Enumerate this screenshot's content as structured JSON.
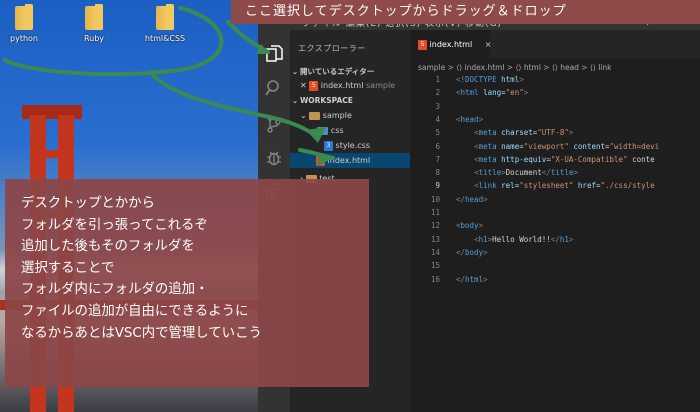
{
  "desktop": {
    "icons": [
      {
        "label": "python"
      },
      {
        "label": "Ruby"
      },
      {
        "label": "html&CSS"
      }
    ]
  },
  "banner": {
    "text": "ここ選択してデスクトップからドラッグ＆ドロップ"
  },
  "note": {
    "lines": [
      "デスクトップとかから",
      "フォルダを引っ張ってこれるぞ",
      "追加した後もそのフォルダを",
      "選択することで",
      "フォルダ内にフォルダの追加・",
      "ファイルの追加が自由にできるように",
      "なるからあとはVSC内で管理していこう"
    ]
  },
  "vscode": {
    "menubar": {
      "items": "ファイル  編集(E)  選択(S)  表示(V)  移動(G)",
      "window_title": "index.html - workspace - Visu"
    },
    "sidebar": {
      "title": "エクスプローラー",
      "open_editors_label": "開いているエディター",
      "open_editor_file": "index.html",
      "open_editor_dir": "sample",
      "workspace_label": "WORKSPACE",
      "tree": {
        "sample": "sample",
        "css": "css",
        "style_css": "style.css",
        "index_html": "index.html",
        "test": "test"
      }
    },
    "tab": {
      "label": "index.html",
      "close": "×"
    },
    "breadcrumb": "sample > ⟨⟩ index.html > ⟨⟩ html > ⟨⟩ head > ⟨⟩ link",
    "current_line": 9,
    "code_lines": [
      "<!DOCTYPE html>",
      "<html lang=\"en\">",
      "",
      "<head>",
      "    <meta charset=\"UTF-8\">",
      "    <meta name=\"viewport\" content=\"width=devi",
      "    <meta http-equiv=\"X-UA-Compatible\" conte",
      "    <title>Document</title>",
      "    <link rel=\"stylesheet\" href=\"./css/style",
      "</head>",
      "",
      "<body>",
      "    <h1>Hello World!!</h1>",
      "</body>",
      "",
      "</html>"
    ]
  },
  "colors": {
    "accent_green": "#3a8a52",
    "banner_bg": "#8f4a4a",
    "note_bg": "#8c4648",
    "selection": "#094771"
  }
}
